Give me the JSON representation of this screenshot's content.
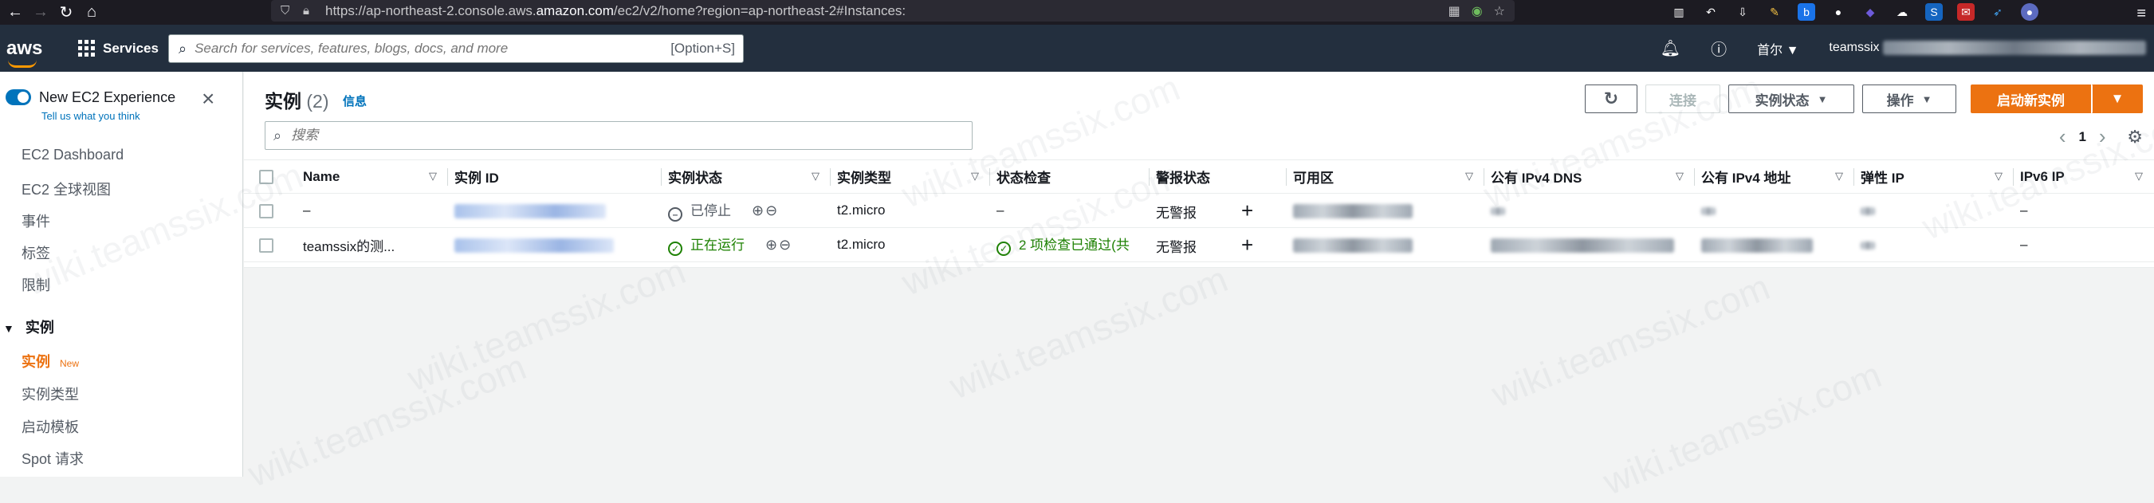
{
  "browser": {
    "url_prefix": "https://ap-northeast-2.console.aws.",
    "url_domain": "amazon.com",
    "url_suffix": "/ec2/v2/home?region=ap-northeast-2#Instances:"
  },
  "header": {
    "logo": "aws",
    "services_label": "Services",
    "search_placeholder": "Search for services, features, blogs, docs, and more",
    "search_shortcut": "[Option+S]",
    "region_label": "首尔",
    "account_prefix": "teamssix"
  },
  "sidebar": {
    "experience_title": "New EC2 Experience",
    "experience_subtitle": "Tell us what you think",
    "items": [
      "EC2 Dashboard",
      "EC2 全球视图",
      "事件",
      "标签",
      "限制"
    ],
    "section_title": "实例",
    "sub_items": [
      {
        "label": "实例",
        "badge": "New"
      },
      {
        "label": "实例类型"
      },
      {
        "label": "启动模板"
      },
      {
        "label": "Spot 请求"
      }
    ]
  },
  "panel": {
    "title": "实例",
    "count": "(2)",
    "info_link": "信息",
    "refresh_icon": "refresh-icon",
    "buttons": {
      "connect": "连接",
      "instance_state": "实例状态",
      "actions": "操作",
      "launch": "启动新实例"
    },
    "search_placeholder": "搜索",
    "page_number": "1"
  },
  "table": {
    "columns": [
      "Name",
      "实例 ID",
      "实例状态",
      "实例类型",
      "状态检查",
      "警报状态",
      "可用区",
      "公有 IPv4 DNS",
      "公有 IPv4 地址",
      "弹性 IP",
      "IPv6 IP"
    ],
    "rows": [
      {
        "name": "–",
        "state": "已停止",
        "type": "t2.micro",
        "check": "–",
        "alarm": "无警报",
        "ipv6": "–"
      },
      {
        "name": "teamssix的测...",
        "state": "正在运行",
        "type": "t2.micro",
        "check": "2 项检查已通过(共",
        "alarm": "无警报",
        "ipv6": "–"
      }
    ]
  },
  "watermark": "wiki.teamssix.com",
  "colors": {
    "aws_header": "#232f3e",
    "accent_orange": "#ec7211",
    "link_blue": "#0073bb",
    "running_green": "#1d8102"
  }
}
